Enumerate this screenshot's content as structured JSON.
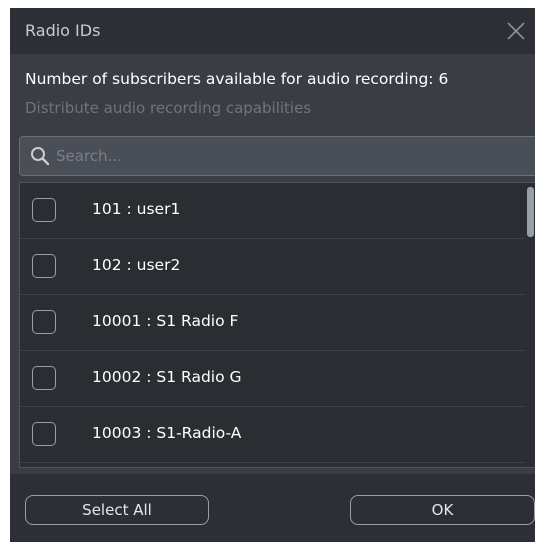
{
  "dialog": {
    "title": "Radio IDs",
    "info_main": "Number of subscribers available for audio recording: 6",
    "info_sub": "Distribute audio recording capabilities"
  },
  "search": {
    "placeholder": "Search...",
    "value": ""
  },
  "list": {
    "items": [
      {
        "label": "101 : user1",
        "checked": false
      },
      {
        "label": "102 : user2",
        "checked": false
      },
      {
        "label": "10001 : S1 Radio F",
        "checked": false
      },
      {
        "label": "10002 : S1 Radio G",
        "checked": false
      },
      {
        "label": "10003 : S1-Radio-A",
        "checked": false
      }
    ]
  },
  "footer": {
    "select_all_label": "Select All",
    "ok_label": "OK"
  },
  "colors": {
    "dialog_bg": "#3a3d44",
    "titlebar_bg": "#2c2f35",
    "list_bg": "#2a2d32"
  },
  "icons": {
    "close": "close-icon",
    "search": "search-icon",
    "checkbox": "checkbox-unchecked-icon"
  }
}
